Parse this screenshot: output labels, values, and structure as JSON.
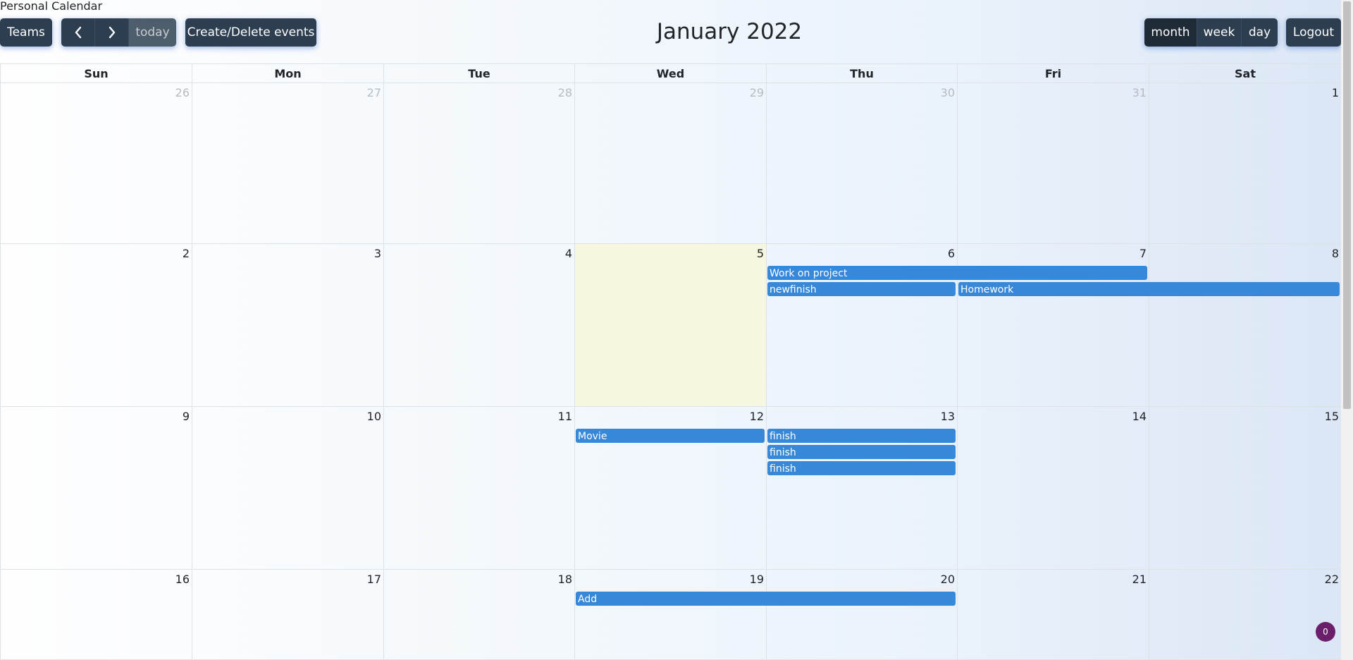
{
  "app": {
    "title": "Personal Calendar"
  },
  "toolbar": {
    "teams_label": "Teams",
    "prev_icon": "chevron-left-icon",
    "next_icon": "chevron-right-icon",
    "today_label": "today",
    "create_delete_label": "Create/Delete events",
    "view_month_label": "month",
    "view_week_label": "week",
    "view_day_label": "day",
    "logout_label": "Logout"
  },
  "calendar": {
    "title": "January 2022",
    "days_of_week": [
      "Sun",
      "Mon",
      "Tue",
      "Wed",
      "Thu",
      "Fri",
      "Sat"
    ],
    "weeks": [
      [
        "26",
        "27",
        "28",
        "29",
        "30",
        "31",
        "1"
      ],
      [
        "2",
        "3",
        "4",
        "5",
        "6",
        "7",
        "8"
      ],
      [
        "9",
        "10",
        "11",
        "12",
        "13",
        "14",
        "15"
      ],
      [
        "16",
        "17",
        "18",
        "19",
        "20",
        "21",
        "22"
      ]
    ],
    "today": "5",
    "events": [
      {
        "title": "Work on project",
        "start": "2022-01-06",
        "end": "2022-01-07"
      },
      {
        "title": "newfinish",
        "start": "2022-01-06",
        "end": "2022-01-06"
      },
      {
        "title": "Homework",
        "start": "2022-01-07",
        "end": "2022-01-08"
      },
      {
        "title": "Movie",
        "start": "2022-01-12",
        "end": "2022-01-12"
      },
      {
        "title": "finish",
        "start": "2022-01-13",
        "end": "2022-01-13"
      },
      {
        "title": "finish",
        "start": "2022-01-13",
        "end": "2022-01-13"
      },
      {
        "title": "finish",
        "start": "2022-01-13",
        "end": "2022-01-13"
      },
      {
        "title": "Add",
        "start": "2022-01-19",
        "end": "2022-01-20"
      }
    ]
  },
  "notification_badge": {
    "count": "0"
  },
  "colors": {
    "button_bg": "#2c3e50",
    "event_bg": "#3788d8",
    "today_bg": "#f6f7dc",
    "badge_bg": "#6b1f6b"
  }
}
